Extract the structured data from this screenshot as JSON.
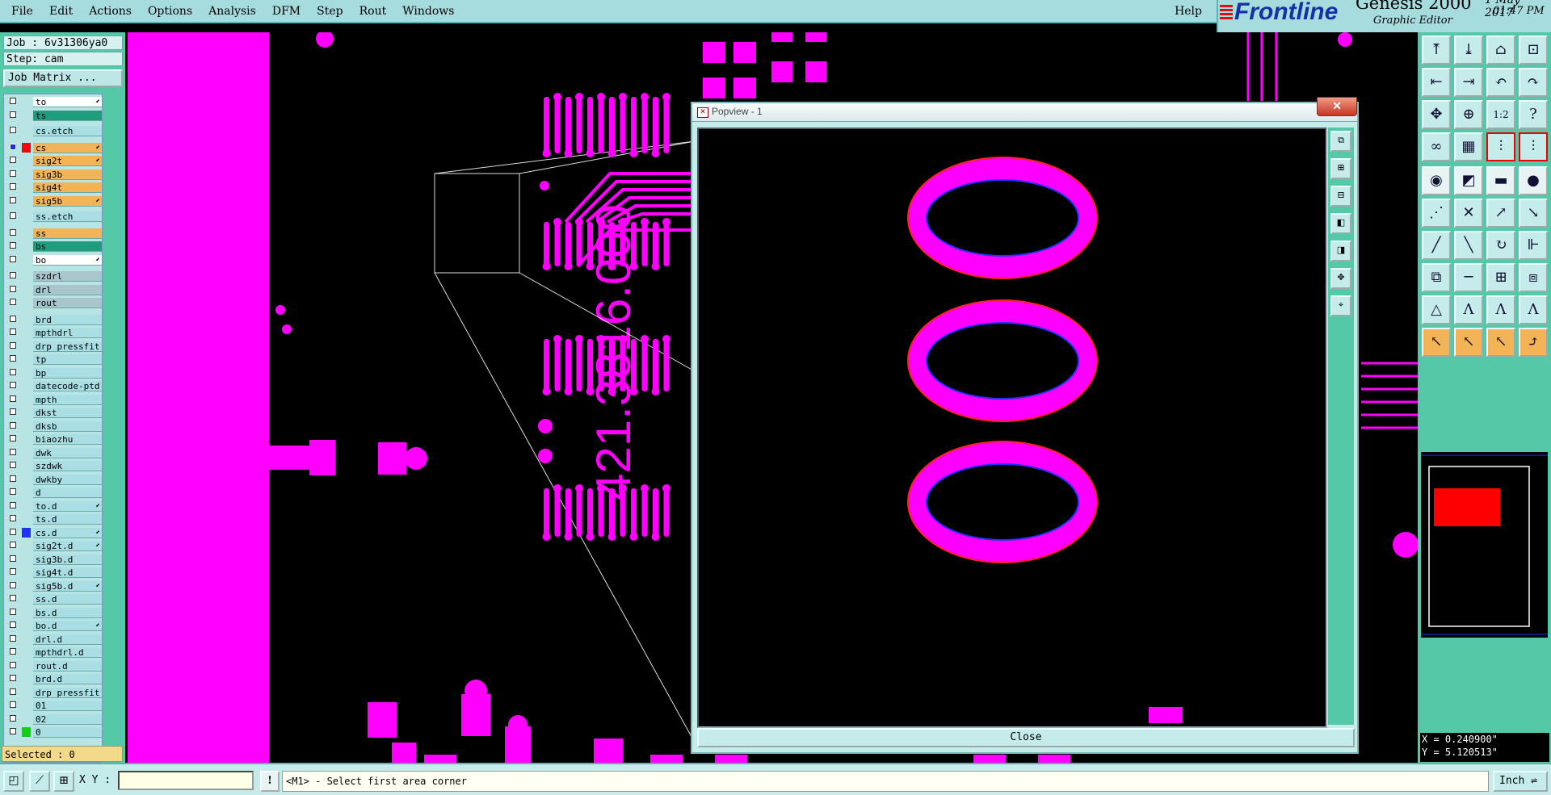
{
  "menu": {
    "items": [
      "File",
      "Edit",
      "Actions",
      "Options",
      "Analysis",
      "DFM",
      "Step",
      "Rout",
      "Windows"
    ],
    "help": "Help"
  },
  "branding": {
    "product": "Frontline",
    "app": "Genesis 2000",
    "subtitle": "Graphic Editor",
    "date": "1  May 2017",
    "time": "01:47 PM"
  },
  "job": {
    "job_line": "Job : 6v31306ya0",
    "step_line": "Step: cam",
    "matrix_label": "Job Matrix ...",
    "selected_line": "Selected : 0"
  },
  "layers": [
    {
      "name": "to",
      "type": "white",
      "flag": "⬋",
      "on": false
    },
    {
      "name": "ts",
      "type": "teal",
      "flag": "",
      "on": false
    },
    {
      "name": "cs.etch",
      "type": "cyan",
      "flag": "",
      "on": false
    },
    {
      "name": "cs",
      "type": "orange",
      "flag": "⬋",
      "on": true,
      "swatch": "#ff0000"
    },
    {
      "name": "sig2t",
      "type": "orange",
      "flag": "⬋",
      "on": false
    },
    {
      "name": "sig3b",
      "type": "orange",
      "flag": "",
      "on": false
    },
    {
      "name": "sig4t",
      "type": "orange",
      "flag": "",
      "on": false
    },
    {
      "name": "sig5b",
      "type": "orange",
      "flag": "⬋",
      "on": false
    },
    {
      "name": "ss.etch",
      "type": "cyan",
      "flag": "",
      "on": false
    },
    {
      "name": "ss",
      "type": "orange",
      "flag": "",
      "on": false
    },
    {
      "name": "bs",
      "type": "teal",
      "flag": "",
      "on": false
    },
    {
      "name": "bo",
      "type": "white",
      "flag": "⬋",
      "on": false
    },
    {
      "name": "szdrl",
      "type": "gray",
      "flag": "",
      "on": false
    },
    {
      "name": "drl",
      "type": "gray",
      "flag": "",
      "on": false
    },
    {
      "name": "rout",
      "type": "gray",
      "flag": "",
      "on": false
    },
    {
      "name": "brd",
      "type": "cyan",
      "flag": "",
      "on": false
    },
    {
      "name": "mpthdrl",
      "type": "cyan",
      "flag": "",
      "on": false
    },
    {
      "name": "drp_pressfit",
      "type": "cyan",
      "flag": "",
      "on": false
    },
    {
      "name": "tp",
      "type": "cyan",
      "flag": "",
      "on": false
    },
    {
      "name": "bp",
      "type": "cyan",
      "flag": "",
      "on": false
    },
    {
      "name": "datecode-ptd",
      "type": "cyan",
      "flag": "",
      "on": false
    },
    {
      "name": "mpth",
      "type": "cyan",
      "flag": "",
      "on": false
    },
    {
      "name": "dkst",
      "type": "cyan",
      "flag": "",
      "on": false
    },
    {
      "name": "dksb",
      "type": "cyan",
      "flag": "",
      "on": false
    },
    {
      "name": "biaozhu",
      "type": "cyan",
      "flag": "",
      "on": false
    },
    {
      "name": "dwk",
      "type": "cyan",
      "flag": "",
      "on": false
    },
    {
      "name": "szdwk",
      "type": "cyan",
      "flag": "",
      "on": false
    },
    {
      "name": "dwkby",
      "type": "cyan",
      "flag": "",
      "on": false
    },
    {
      "name": "d",
      "type": "cyan",
      "flag": "",
      "on": false
    },
    {
      "name": "to.d",
      "type": "cyan",
      "flag": "⬋",
      "on": false
    },
    {
      "name": "ts.d",
      "type": "cyan",
      "flag": "",
      "on": false
    },
    {
      "name": "cs.d",
      "type": "cyan",
      "flag": "⬋",
      "on": false,
      "swatch": "#2030ff"
    },
    {
      "name": "sig2t.d",
      "type": "cyan",
      "flag": "⬋",
      "on": false
    },
    {
      "name": "sig3b.d",
      "type": "cyan",
      "flag": "",
      "on": false
    },
    {
      "name": "sig4t.d",
      "type": "cyan",
      "flag": "",
      "on": false
    },
    {
      "name": "sig5b.d",
      "type": "cyan",
      "flag": "⬋",
      "on": false
    },
    {
      "name": "ss.d",
      "type": "cyan",
      "flag": "",
      "on": false
    },
    {
      "name": "bs.d",
      "type": "cyan",
      "flag": "",
      "on": false
    },
    {
      "name": "bo.d",
      "type": "cyan",
      "flag": "⬋",
      "on": false
    },
    {
      "name": "drl.d",
      "type": "cyan",
      "flag": "",
      "on": false
    },
    {
      "name": "mpthdrl.d",
      "type": "cyan",
      "flag": "",
      "on": false
    },
    {
      "name": "rout.d",
      "type": "cyan",
      "flag": "",
      "on": false
    },
    {
      "name": "brd.d",
      "type": "cyan",
      "flag": "",
      "on": false
    },
    {
      "name": "drp_pressfit",
      "type": "cyan",
      "flag": "",
      "on": false
    },
    {
      "name": "01",
      "type": "cyan",
      "flag": "",
      "on": false
    },
    {
      "name": "02",
      "type": "cyan",
      "flag": "",
      "on": false
    },
    {
      "name": "0",
      "type": "cyan",
      "flag": "",
      "on": false,
      "swatch": "#10d010"
    }
  ],
  "canvas": {
    "board_text": "421.3816.000",
    "colors": {
      "feature": "#ff00ff",
      "outline": "#ff2020",
      "hole": "#2030ff",
      "background": "#000000"
    }
  },
  "popview": {
    "title": "Popview - 1",
    "zoom_text": "000",
    "close_label": "Close"
  },
  "toolbox": {
    "icons": [
      "zoom-in-icon",
      "zoom-out-icon",
      "home-icon",
      "fit-icon",
      "pan-left-icon",
      "pan-right-icon",
      "undo-icon",
      "redo-icon",
      "center-icon",
      "zoom-area-icon",
      "one-to-one-icon",
      "help-icon",
      "measure-icon",
      "grid-icon",
      "layers-a-icon",
      "layers-b-icon",
      "add-pad-icon",
      "add-line-icon",
      "ruler-icon",
      "circle-icon",
      "snap-icon",
      "intersect-icon",
      "connect-icon",
      "join-icon",
      "move-icon",
      "cut-icon",
      "arc-icon",
      "flip-icon",
      "copy-icon",
      "line-tool-icon",
      "resize-icon",
      "mirror-icon",
      "triangle-icon",
      "arc-a-icon",
      "arc-b-icon",
      "arc-c-icon",
      "cursor-icon",
      "select-icon",
      "arrow-select-icon",
      "route-icon"
    ]
  },
  "coords": {
    "x": "X = 0.240900\"",
    "y": "Y = 5.120513\""
  },
  "bottom": {
    "xy_label": "X Y :",
    "xy_value": "",
    "excl": "!",
    "message": "<M1> - Select first area corner",
    "unit": "Inch"
  }
}
